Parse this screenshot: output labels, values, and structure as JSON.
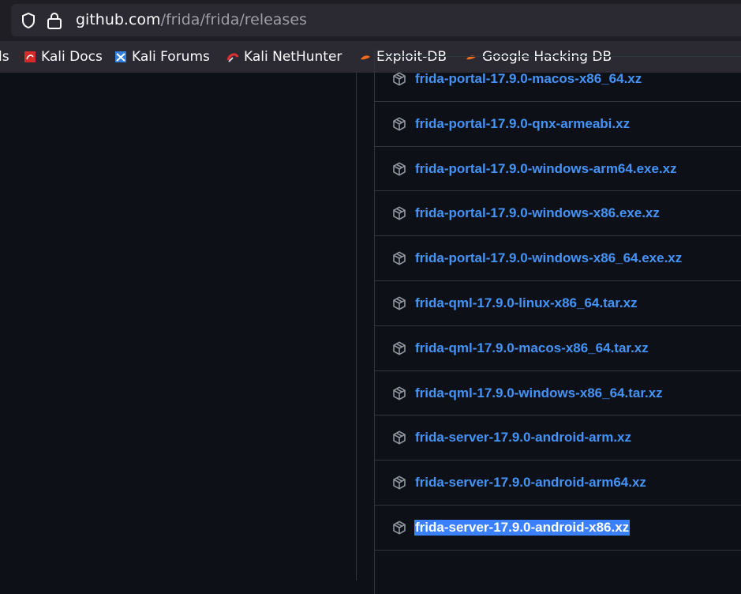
{
  "browser": {
    "url_host": "github.com",
    "url_path": "/frida/frida/releases"
  },
  "bookmarks": [
    {
      "label": "ls",
      "icon": "bookmark-icon"
    },
    {
      "label": "Kali Docs",
      "icon": "kali-docs-icon"
    },
    {
      "label": "Kali Forums",
      "icon": "kali-forums-icon"
    },
    {
      "label": "Kali NetHunter",
      "icon": "kali-nethunter-icon"
    },
    {
      "label": "Exploit-DB",
      "icon": "exploit-db-icon"
    },
    {
      "label": "Google Hacking DB",
      "icon": "ghdb-icon"
    }
  ],
  "assets": [
    {
      "name": "frida-portal-17.9.0-macos-x86_64.xz"
    },
    {
      "name": "frida-portal-17.9.0-qnx-armeabi.xz"
    },
    {
      "name": "frida-portal-17.9.0-windows-arm64.exe.xz"
    },
    {
      "name": "frida-portal-17.9.0-windows-x86.exe.xz"
    },
    {
      "name": "frida-portal-17.9.0-windows-x86_64.exe.xz"
    },
    {
      "name": "frida-qml-17.9.0-linux-x86_64.tar.xz"
    },
    {
      "name": "frida-qml-17.9.0-macos-x86_64.tar.xz"
    },
    {
      "name": "frida-qml-17.9.0-windows-x86_64.tar.xz"
    },
    {
      "name": "frida-server-17.9.0-android-arm.xz"
    },
    {
      "name": "frida-server-17.9.0-android-arm64.xz"
    },
    {
      "name": "frida-server-17.9.0-android-x86.xz"
    }
  ],
  "selected_asset_index": 10,
  "colors": {
    "link": "#4493f8",
    "selection": "#3a80ff",
    "page_bg": "#0d1117",
    "border": "#30363d"
  }
}
